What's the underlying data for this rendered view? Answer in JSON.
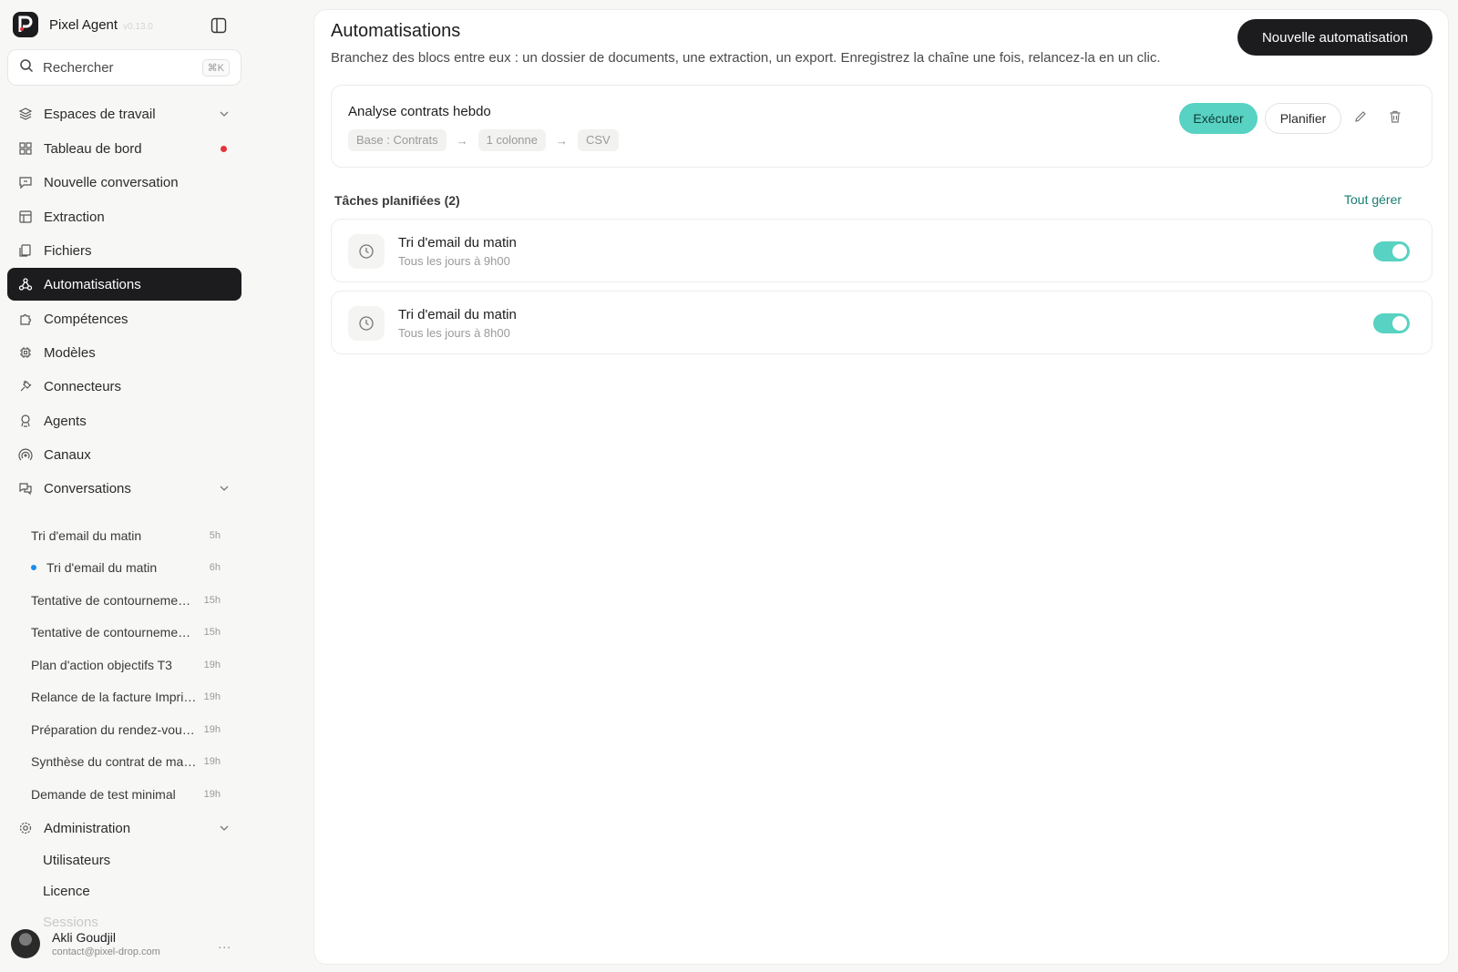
{
  "app": {
    "name": "Pixel Agent",
    "version": "v0.13.0"
  },
  "search": {
    "label": "Rechercher",
    "shortcut": "⌘K"
  },
  "nav": {
    "workspaces": "Espaces de travail",
    "dashboard": "Tableau de bord",
    "new_conversation": "Nouvelle conversation",
    "extraction": "Extraction",
    "files": "Fichiers",
    "automations": "Automatisations",
    "skills": "Compétences",
    "models": "Modèles",
    "connectors": "Connecteurs",
    "agents": "Agents",
    "channels": "Canaux",
    "conversations": "Conversations",
    "administration": "Administration"
  },
  "conversations": [
    {
      "title": "Tri d'email du matin",
      "time": "5h",
      "active": false
    },
    {
      "title": "Tri d'email du matin",
      "time": "6h",
      "active": true
    },
    {
      "title": "Tentative de contournement de sécurité",
      "time": "15h",
      "active": false
    },
    {
      "title": "Tentative de contournement de sécurité",
      "time": "15h",
      "active": false
    },
    {
      "title": "Plan d'action objectifs T3",
      "time": "19h",
      "active": false
    },
    {
      "title": "Relance de la facture Imprimerie",
      "time": "19h",
      "active": false
    },
    {
      "title": "Préparation du rendez-vous client",
      "time": "19h",
      "active": false
    },
    {
      "title": "Synthèse du contrat de maintenance",
      "time": "19h",
      "active": false
    },
    {
      "title": "Demande de test minimal",
      "time": "19h",
      "active": false
    }
  ],
  "admin": {
    "users": "Utilisateurs",
    "license": "Licence",
    "sessions": "Sessions"
  },
  "user": {
    "name": "Akli Goudjil",
    "email": "contact@pixel-drop.com",
    "more": "..."
  },
  "page": {
    "title": "Automatisations",
    "description": "Branchez des blocs entre eux : un dossier de documents, une extraction, un export. Enregistrez la chaîne une fois, relancez-la en un clic.",
    "new_button": "Nouvelle automatisation"
  },
  "automation": {
    "name": "Analyse contrats hebdo",
    "steps": [
      "Base : Contrats",
      "1 colonne",
      "CSV"
    ],
    "arrow": "→",
    "run": "Exécuter",
    "schedule": "Planifier"
  },
  "tasks": {
    "title": "Tâches planifiées (2)",
    "manage": "Tout gérer",
    "items": [
      {
        "name": "Tri d'email du matin",
        "schedule": "Tous les jours à 9h00",
        "enabled": true
      },
      {
        "name": "Tri d'email du matin",
        "schedule": "Tous les jours à 8h00",
        "enabled": true
      }
    ]
  },
  "colors": {
    "accent": "#58d2c2",
    "active_nav": "#1c1c1e",
    "link": "#177c70",
    "notification": "#e5333a",
    "active_dot": "#1a8cf0"
  }
}
